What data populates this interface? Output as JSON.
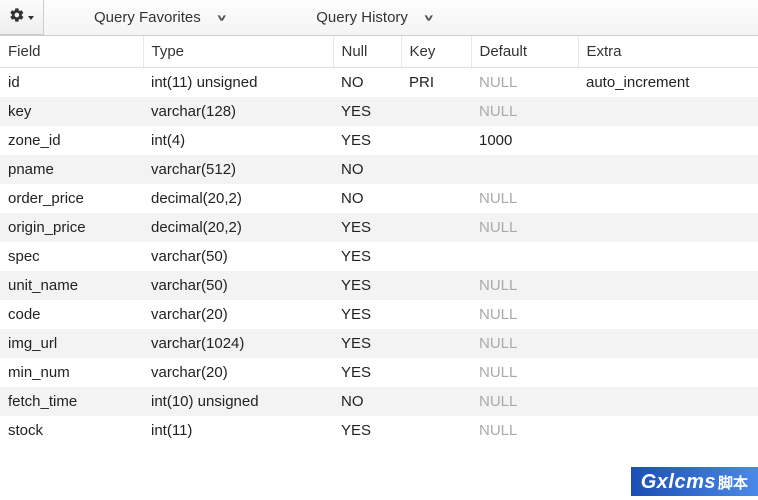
{
  "toolbar": {
    "favorites_label": "Query Favorites",
    "history_label": "Query History"
  },
  "columns": {
    "field": "Field",
    "type": "Type",
    "null": "Null",
    "key": "Key",
    "default": "Default",
    "extra": "Extra"
  },
  "rows": [
    {
      "field": "id",
      "type": "int(11) unsigned",
      "null": "NO",
      "key": "PRI",
      "default": "NULL",
      "default_is_null": true,
      "extra": "auto_increment"
    },
    {
      "field": "key",
      "type": "varchar(128)",
      "null": "YES",
      "key": "",
      "default": "NULL",
      "default_is_null": true,
      "extra": ""
    },
    {
      "field": "zone_id",
      "type": "int(4)",
      "null": "YES",
      "key": "",
      "default": "1000",
      "default_is_null": false,
      "extra": ""
    },
    {
      "field": "pname",
      "type": "varchar(512)",
      "null": "NO",
      "key": "",
      "default": "",
      "default_is_null": false,
      "extra": ""
    },
    {
      "field": "order_price",
      "type": "decimal(20,2)",
      "null": "NO",
      "key": "",
      "default": "NULL",
      "default_is_null": true,
      "extra": ""
    },
    {
      "field": "origin_price",
      "type": "decimal(20,2)",
      "null": "YES",
      "key": "",
      "default": "NULL",
      "default_is_null": true,
      "extra": ""
    },
    {
      "field": "spec",
      "type": "varchar(50)",
      "null": "YES",
      "key": "",
      "default": "",
      "default_is_null": false,
      "extra": ""
    },
    {
      "field": "unit_name",
      "type": "varchar(50)",
      "null": "YES",
      "key": "",
      "default": "NULL",
      "default_is_null": true,
      "extra": ""
    },
    {
      "field": "code",
      "type": "varchar(20)",
      "null": "YES",
      "key": "",
      "default": "NULL",
      "default_is_null": true,
      "extra": ""
    },
    {
      "field": "img_url",
      "type": "varchar(1024)",
      "null": "YES",
      "key": "",
      "default": "NULL",
      "default_is_null": true,
      "extra": ""
    },
    {
      "field": "min_num",
      "type": "varchar(20)",
      "null": "YES",
      "key": "",
      "default": "NULL",
      "default_is_null": true,
      "extra": ""
    },
    {
      "field": "fetch_time",
      "type": "int(10) unsigned",
      "null": "NO",
      "key": "",
      "default": "NULL",
      "default_is_null": true,
      "extra": ""
    },
    {
      "field": "stock",
      "type": "int(11)",
      "null": "YES",
      "key": "",
      "default": "NULL",
      "default_is_null": true,
      "extra": ""
    }
  ],
  "watermark": {
    "main": "Gxlcms",
    "sub": "脚本"
  }
}
